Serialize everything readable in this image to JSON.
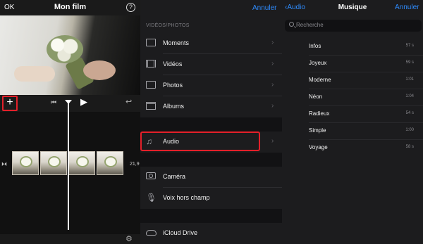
{
  "editor": {
    "ok_label": "OK",
    "title": "Mon film",
    "help_glyph": "?",
    "add_glyph": "+",
    "skip_glyph": "⏮",
    "play_glyph": "▶",
    "undo_glyph": "↩",
    "clip_duration": "21,9",
    "settings_glyph": "⚙"
  },
  "import_menu": {
    "cancel_label": "Annuler",
    "section_label": "VIDÉOS/PHOTOS",
    "items": [
      {
        "label": "Moments",
        "icon": "moments-icon"
      },
      {
        "label": "Vidéos",
        "icon": "film-icon"
      },
      {
        "label": "Photos",
        "icon": "photo-icon"
      },
      {
        "label": "Albums",
        "icon": "album-icon"
      },
      {
        "label": "Audio",
        "icon": "music-note-icon",
        "highlighted": true
      },
      {
        "label": "Caméra",
        "icon": "camera-icon"
      },
      {
        "label": "Voix hors champ",
        "icon": "microphone-icon"
      },
      {
        "label": "iCloud Drive",
        "icon": "cloud-icon"
      }
    ],
    "chevron": "›",
    "highlight_color": "#e4202a"
  },
  "music": {
    "back_label": "Audio",
    "back_glyph": "‹",
    "title": "Musique",
    "cancel_label": "Annuler",
    "search_placeholder": "Recherche",
    "songs": [
      {
        "name": "Infos",
        "duration": "57 s"
      },
      {
        "name": "Joyeux",
        "duration": "59 s"
      },
      {
        "name": "Moderne",
        "duration": "1:01"
      },
      {
        "name": "Néon",
        "duration": "1:04"
      },
      {
        "name": "Radieux",
        "duration": "54 s"
      },
      {
        "name": "Simple",
        "duration": "1:00"
      },
      {
        "name": "Voyage",
        "duration": "58 s"
      }
    ]
  },
  "colors": {
    "accent": "#2e8cff",
    "highlight": "#e4202a",
    "background": "#1c1c1e"
  }
}
